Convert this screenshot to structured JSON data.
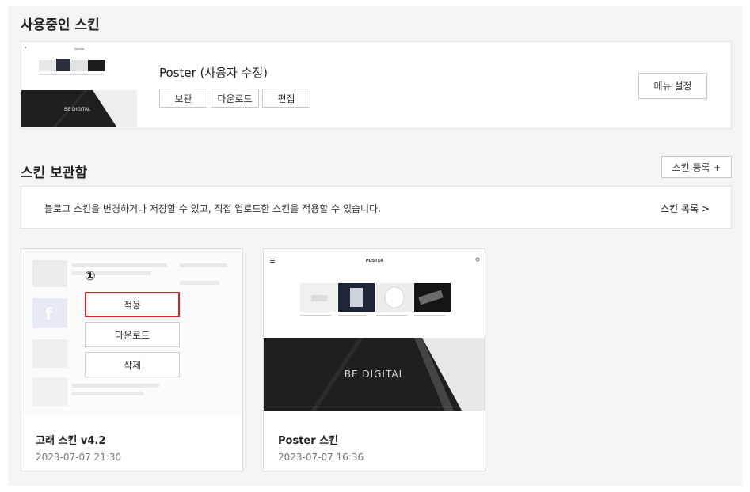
{
  "current_skin": {
    "section_title": "사용중인 스킨",
    "name": "Poster (사용자 수정)",
    "buttons": [
      "보관",
      "다운로드",
      "편집"
    ],
    "menu_settings": "메뉴 설정",
    "preview": {
      "logo": "POSTER",
      "tagline": "BE DIGITAL"
    }
  },
  "storage": {
    "section_title": "스킨 보관함",
    "register_label": "스킨 등록 +",
    "info_text": "블로그 스킨을 변경하거나 저장할 수 있고, 직접 업로드한 스킨을 적용할 수 있습니다.",
    "list_link": "스킨 목록 >"
  },
  "cards": [
    {
      "name": "고래 스킨 v4.2",
      "date": "2023-07-07 21:30",
      "step_badge": "①",
      "actions": {
        "apply": "적용",
        "download": "다운로드",
        "delete": "삭제"
      }
    },
    {
      "name": "Poster 스킨",
      "date": "2023-07-07 16:36",
      "preview": {
        "logo": "POSTER",
        "tagline": "BE DIGITAL"
      }
    }
  ],
  "colors": {
    "highlight": "#d9232a",
    "dark_banner": "#1f1f1f"
  }
}
